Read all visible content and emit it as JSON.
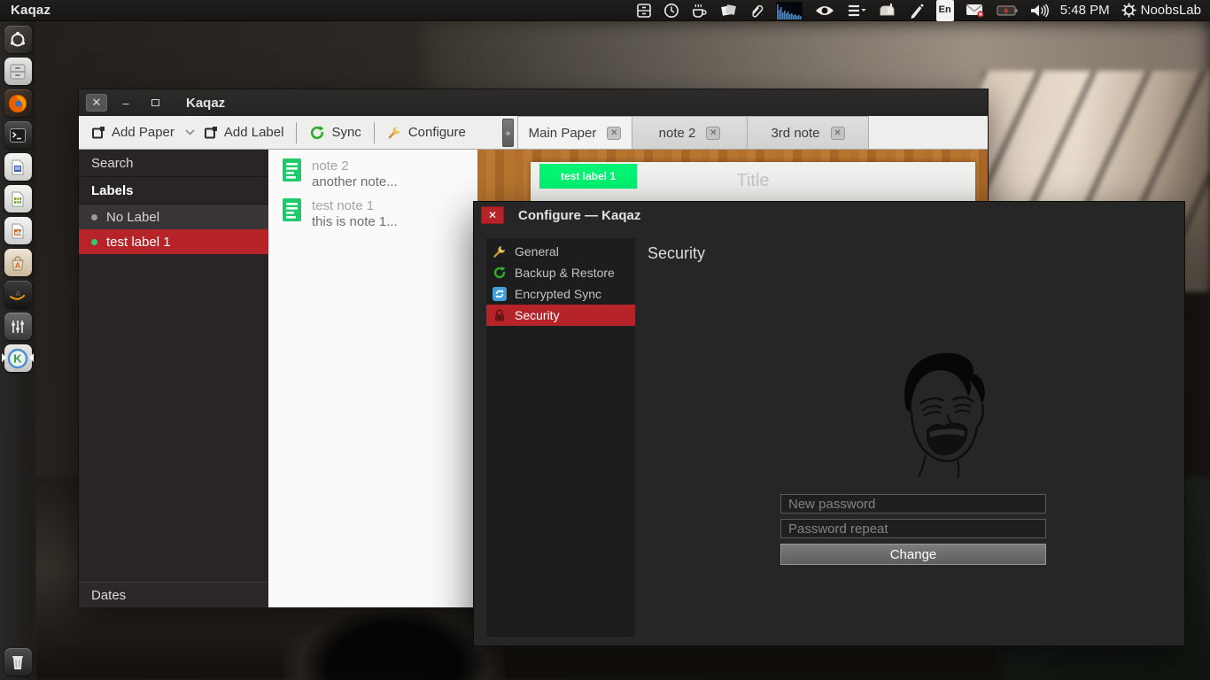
{
  "panel": {
    "app_title": "Kaqaz",
    "time": "5:48 PM",
    "session_label": "NoobsLab",
    "keyboard_layout": "En",
    "tray_icons": [
      "archive-drawer",
      "clock",
      "coffee-break",
      "sticky-notes",
      "paperclip-attach",
      "system-monitor-graph",
      "eye-privacy",
      "indicator-menu",
      "mailbox",
      "tablet-pen",
      "keyboard-layout",
      "mail-notifier",
      "power-battery",
      "volume",
      "session-gear"
    ]
  },
  "launcher": {
    "items": [
      {
        "name": "ubuntu-dash"
      },
      {
        "name": "files"
      },
      {
        "name": "firefox"
      },
      {
        "name": "terminal"
      },
      {
        "name": "libreoffice-writer"
      },
      {
        "name": "libreoffice-calc"
      },
      {
        "name": "libreoffice-impress"
      },
      {
        "name": "software-center"
      },
      {
        "name": "amazon"
      },
      {
        "name": "system-settings"
      },
      {
        "name": "kaqaz",
        "active": true
      },
      {
        "name": "trash"
      }
    ]
  },
  "kaqaz": {
    "window_title": "Kaqaz",
    "toolbar": {
      "add_paper": "Add Paper",
      "add_label": "Add Label",
      "sync": "Sync",
      "configure": "Configure",
      "overflow": "»"
    },
    "tabs": [
      {
        "label": "Main Paper",
        "active": true
      },
      {
        "label": "note 2",
        "active": false
      },
      {
        "label": "3rd note",
        "active": false
      }
    ],
    "sidebar": {
      "search": "Search",
      "labels_header": "Labels",
      "items": [
        {
          "name": "No Label",
          "dot_color": "#9a9a9a",
          "selected": false
        },
        {
          "name": "test label 1",
          "dot_color": "#2ecc71",
          "selected": true
        }
      ],
      "dates": "Dates"
    },
    "notes": [
      {
        "title": "note 2",
        "preview": "another note..."
      },
      {
        "title": "test note 1",
        "preview": "this is note 1..."
      }
    ],
    "paper": {
      "tag": "test label 1",
      "title_placeholder": "Title"
    }
  },
  "configure": {
    "title": "Configure — Kaqaz",
    "nav": [
      {
        "label": "General",
        "icon": "wrench-icon",
        "selected": false
      },
      {
        "label": "Backup & Restore",
        "icon": "restore-icon",
        "selected": false
      },
      {
        "label": "Encrypted Sync",
        "icon": "encrypted-sync-icon",
        "selected": false
      },
      {
        "label": "Security",
        "icon": "lock-icon",
        "selected": true
      }
    ],
    "heading": "Security",
    "form": {
      "new_password_placeholder": "New password",
      "password_repeat_placeholder": "Password repeat",
      "change_label": "Change"
    }
  },
  "colors": {
    "selection_red": "#b6242a",
    "paper_tag_green": "#00f573",
    "note_icon_green": "#1dcb6c",
    "sync_green": "#2eab2e",
    "encrypted_blue": "#3f9fd8",
    "wood_brown": "#b5722f"
  }
}
